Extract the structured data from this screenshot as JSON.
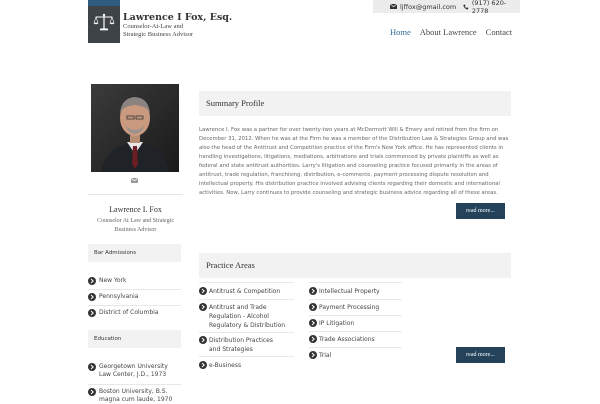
{
  "header": {
    "email": "ljffox@gmail.com",
    "phone": "(917) 620-2778",
    "brand_name": "Lawrence I Fox, Esq.",
    "brand_tagline": "Counselor-At-Law and Strategic Business Advisor",
    "nav": [
      {
        "label": "Home",
        "active": true
      },
      {
        "label": "About Lawrence",
        "active": false
      },
      {
        "label": "Contact",
        "active": false
      }
    ]
  },
  "sidebar": {
    "name": "Lawrence I. Fox",
    "title": "Counselor At Law and Strategic Business Advisor",
    "bar_admissions": {
      "heading": "Bar Admissions",
      "items": [
        "New York",
        "Pennsylvania",
        "District of Columbia"
      ]
    },
    "education": {
      "heading": "Education",
      "items": [
        "Georgetown University Law Center, J.D., 1973",
        "Boston University, B.S. magna cum laude, 1970"
      ]
    }
  },
  "summary": {
    "heading": "Summary Profile",
    "text": "Lawrence I. Fox was a partner for over twenty-two years at McDermott Will & Emery and retired from the firm on December 31, 2012. When he was at the Firm he was a member of the Distribution Law & Strategies Group and was also the head of the Antitrust and Competition practice of the Firm's New York office. He has represented clients in handling investigations, litigations, mediations, arbitrations and trials commenced by private plaintiffs as well as federal and state antitrust authorities. Larry's litigation and counseling practice focused primarily in the areas of antitrust, trade regulation, franchising, distribution, e-commerce, payment processing dispute resolution and intellectual property. His distribution practice involved advising clients regarding their domestic and international activities. Now, Larry continues to provide counseling and strategic business advice regarding all of these areas.",
    "read_more": "read more..."
  },
  "practice_areas": {
    "heading": "Practice Areas",
    "left": [
      "Antitrust & Competition",
      "Antitrust and Trade Regulation - Alcohol Regulatory & Distribution",
      "Distribution Practices and Strategies",
      "e-Business"
    ],
    "right": [
      "Intellectual Property",
      "Payment Processing",
      "IP Litigation",
      "Trade Associations",
      "Trial"
    ],
    "read_more": "read more..."
  },
  "colors": {
    "accent": "#2c6a94",
    "button": "#24435a",
    "panel": "#f2f2f2",
    "logo_bg": "#3e4347"
  }
}
